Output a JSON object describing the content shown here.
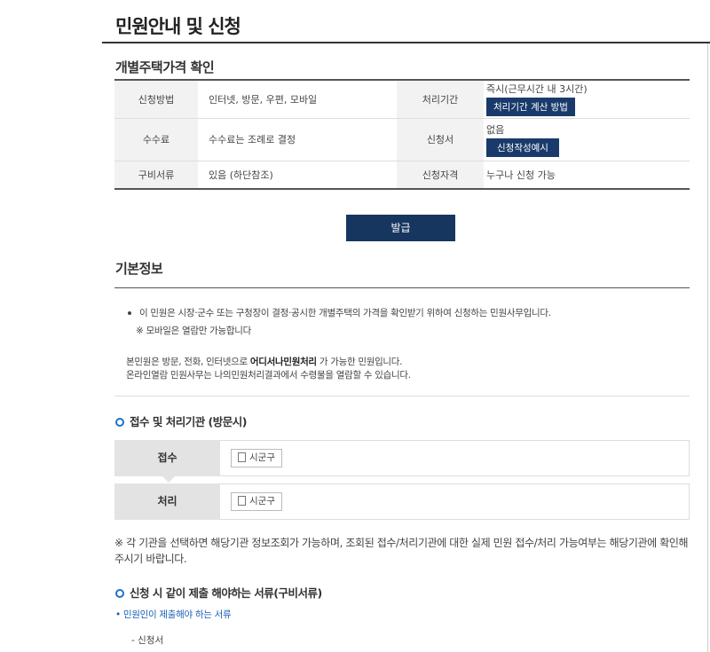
{
  "page": {
    "title": "민원안내 및 신청"
  },
  "section": {
    "title": "개별주택가격 확인"
  },
  "table": {
    "method_label": "신청방법",
    "method_value": "인터넷, 방문, 우편, 모바일",
    "period_label": "처리기간",
    "period_value": "즉시(근무시간 내 3시간)",
    "period_button": "처리기간 계산 방법",
    "fee_label": "수수료",
    "fee_value": "수수료는 조례로 결정",
    "form_label": "신청서",
    "form_value": "없음",
    "form_button": "신청작성예시",
    "docs_label": "구비서류",
    "docs_value": "있음 (하단참조)",
    "qual_label": "신청자격",
    "qual_value": "누구나 신청 가능"
  },
  "issue_button": "발급",
  "basic": {
    "title": "기본정보",
    "line1": "이 민원은 시장·군수 또는 구청장이 결정·공시한 개별주택의 가격을 확인받기 위하여 신청하는 민원사무입니다.",
    "line2": "※ 모바일은 열람만 가능합니다",
    "line3_pre": "본민원은 방문, 전화, 인터넷으로 ",
    "line3_bold": "어디서나민원처리",
    "line3_post": " 가 가능한 민원입니다.",
    "line4": "온라인열람 민원사무는 나의민원처리결과에서 수령물을 열람할 수 있습니다."
  },
  "agency": {
    "title": "접수 및 처리기관 (방문시)",
    "receive_label": "접수",
    "receive_office": "시군구",
    "process_label": "처리",
    "process_office": "시군구",
    "note": "※ 각 기관을 선택하면 해당기관 정보조회가 가능하며, 조회된 접수/처리기관에 대한 실제 민원 접수/처리 가능여부는 해당기관에 확인해 주시기 바랍니다."
  },
  "docs": {
    "title": "신청 시 같이 제출 해야하는 서류(구비서류)",
    "link": "• 민원인이 제출해야 하는 서류",
    "item1": "- 신청서"
  },
  "colors": {
    "navy": "#16365f",
    "accent_blue": "#1a73c9",
    "link_blue": "#1a5fb4"
  }
}
